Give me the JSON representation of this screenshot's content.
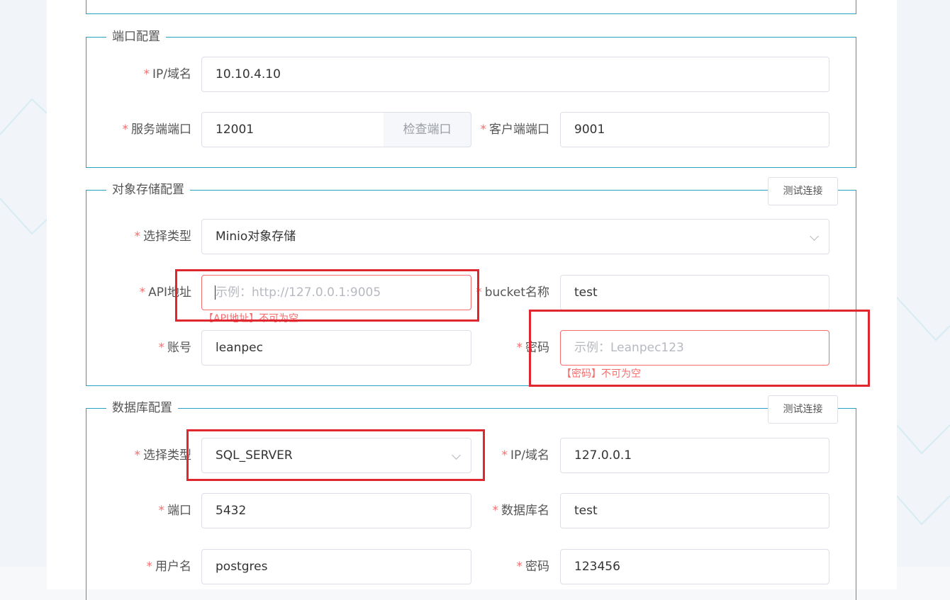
{
  "port_config": {
    "legend": "端口配置",
    "ip_label": "IP/域名",
    "ip_value": "10.10.4.10",
    "server_port_label": "服务端端口",
    "server_port_value": "12001",
    "check_port_button": "检查端口",
    "client_port_label": "客户端端口",
    "client_port_value": "9001"
  },
  "object_storage": {
    "legend": "对象存储配置",
    "test_button": "测试连接",
    "type_label": "选择类型",
    "type_value": "Minio对象存储",
    "api_label": "API地址",
    "api_placeholder": "示例：http://127.0.0.1:9005",
    "api_error": "【API地址】不可为空",
    "bucket_label": "bucket名称",
    "bucket_value": "test",
    "account_label": "账号",
    "account_value": "leanpec",
    "password_label": "密码",
    "password_placeholder": "示例：Leanpec123",
    "password_error": "【密码】不可为空"
  },
  "database": {
    "legend": "数据库配置",
    "test_button": "测试连接",
    "type_label": "选择类型",
    "type_value": "SQL_SERVER",
    "ip_label": "IP/域名",
    "ip_value": "127.0.0.1",
    "port_label": "端口",
    "port_value": "5432",
    "dbname_label": "数据库名",
    "dbname_value": "test",
    "user_label": "用户名",
    "user_value": "postgres",
    "password_label": "密码",
    "password_value": "123456"
  },
  "colors": {
    "border_accent": "#2aa0c4",
    "required_star": "#f56c6c",
    "annotation_red": "#e0262e"
  }
}
